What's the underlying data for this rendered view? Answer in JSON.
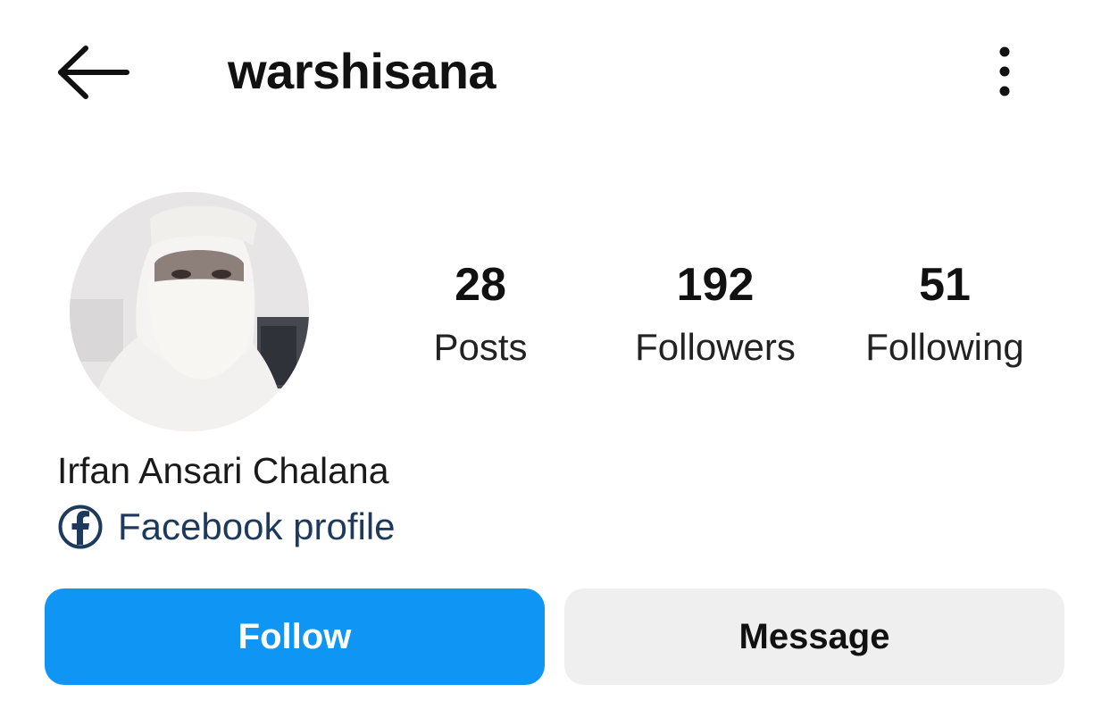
{
  "header": {
    "username": "warshisana",
    "back_icon": "arrow-left-icon",
    "more_icon": "more-vertical-icon"
  },
  "profile": {
    "avatar_icon": "profile-photo",
    "display_name": "Irfan Ansari Chalana",
    "facebook_link": {
      "icon": "facebook-icon",
      "label": "Facebook profile"
    }
  },
  "stats": {
    "posts": {
      "value": "28",
      "label": "Posts"
    },
    "followers": {
      "value": "192",
      "label": "Followers"
    },
    "following": {
      "value": "51",
      "label": "Following"
    }
  },
  "actions": {
    "follow_label": "Follow",
    "message_label": "Message"
  },
  "colors": {
    "follow_button": "#0f95f4",
    "message_button": "#efefef",
    "link_text": "#1d3a5c"
  }
}
